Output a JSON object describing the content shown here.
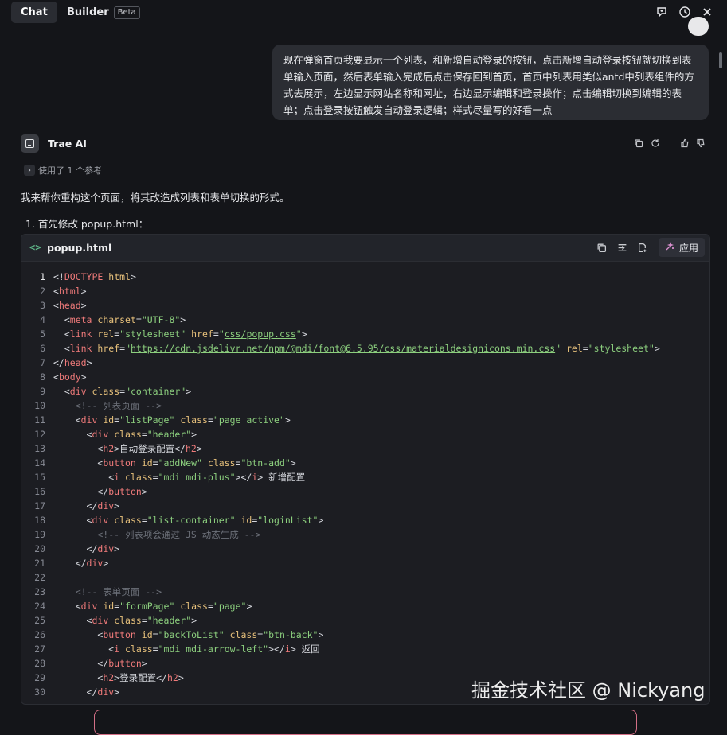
{
  "tabs": {
    "chat": "Chat",
    "builder": "Builder",
    "beta": "Beta"
  },
  "top_icons": [
    "new-chat-icon",
    "history-icon",
    "close-icon"
  ],
  "user_message": "现在弹窗首页我要显示一个列表，和新增自动登录的按钮，点击新增自动登录按钮就切换到表单输入页面，然后表单输入完成后点击保存回到首页，首页中列表用类似antd中列表组件的方式去展示，左边显示网站名称和网址，右边显示编辑和登录操作；点击编辑切换到编辑的表单；点击登录按钮触发自动登录逻辑；样式尽量写的好看一点",
  "ai": {
    "name": "Trae AI",
    "reference": "使用了 1 个参考",
    "intro": "我来帮你重构这个页面，将其改造成列表和表单切换的形式。",
    "step": "1. 首先修改 popup.html："
  },
  "code_block": {
    "filename": "popup.html",
    "apply_label": "应用",
    "current_line": 1,
    "lines": [
      {
        "n": "1",
        "tokens": [
          [
            "p",
            "<!"
          ],
          [
            "tag",
            "DOCTYPE"
          ],
          [
            "p",
            " "
          ],
          [
            "attr",
            "html"
          ],
          [
            "p",
            ">"
          ]
        ]
      },
      {
        "n": "2",
        "tokens": [
          [
            "p",
            "<"
          ],
          [
            "tag",
            "html"
          ],
          [
            "p",
            ">"
          ]
        ]
      },
      {
        "n": "3",
        "tokens": [
          [
            "p",
            "<"
          ],
          [
            "tag",
            "head"
          ],
          [
            "p",
            ">"
          ]
        ]
      },
      {
        "n": "4",
        "tokens": [
          [
            "p",
            "  <"
          ],
          [
            "tag",
            "meta"
          ],
          [
            "p",
            " "
          ],
          [
            "attr",
            "charset"
          ],
          [
            "p",
            "="
          ],
          [
            "str",
            "\"UTF-8\""
          ],
          [
            "p",
            ">"
          ]
        ]
      },
      {
        "n": "5",
        "tokens": [
          [
            "p",
            "  <"
          ],
          [
            "tag",
            "link"
          ],
          [
            "p",
            " "
          ],
          [
            "attr",
            "rel"
          ],
          [
            "p",
            "="
          ],
          [
            "str",
            "\"stylesheet\""
          ],
          [
            "p",
            " "
          ],
          [
            "attr",
            "href"
          ],
          [
            "p",
            "="
          ],
          [
            "str",
            "\""
          ],
          [
            "url",
            "css/popup.css"
          ],
          [
            "str",
            "\""
          ],
          [
            "p",
            ">"
          ]
        ]
      },
      {
        "n": "6",
        "tokens": [
          [
            "p",
            "  <"
          ],
          [
            "tag",
            "link"
          ],
          [
            "p",
            " "
          ],
          [
            "attr",
            "href"
          ],
          [
            "p",
            "="
          ],
          [
            "str",
            "\""
          ],
          [
            "url",
            "https://cdn.jsdelivr.net/npm/@mdi/font@6.5.95/css/materialdesignicons.min.css"
          ],
          [
            "str",
            "\""
          ],
          [
            "p",
            " "
          ],
          [
            "attr",
            "rel"
          ],
          [
            "p",
            "="
          ],
          [
            "str",
            "\"stylesheet\""
          ],
          [
            "p",
            ">"
          ]
        ]
      },
      {
        "n": "7",
        "tokens": [
          [
            "p",
            "</"
          ],
          [
            "tag",
            "head"
          ],
          [
            "p",
            ">"
          ]
        ]
      },
      {
        "n": "8",
        "tokens": [
          [
            "p",
            "<"
          ],
          [
            "tag",
            "body"
          ],
          [
            "p",
            ">"
          ]
        ]
      },
      {
        "n": "9",
        "tokens": [
          [
            "p",
            "  <"
          ],
          [
            "tag",
            "div"
          ],
          [
            "p",
            " "
          ],
          [
            "attr",
            "class"
          ],
          [
            "p",
            "="
          ],
          [
            "str",
            "\"container\""
          ],
          [
            "p",
            ">"
          ]
        ]
      },
      {
        "n": "10",
        "tokens": [
          [
            "cmt",
            "    <!-- 列表页面 -->"
          ]
        ]
      },
      {
        "n": "11",
        "tokens": [
          [
            "p",
            "    <"
          ],
          [
            "tag",
            "div"
          ],
          [
            "p",
            " "
          ],
          [
            "attr",
            "id"
          ],
          [
            "p",
            "="
          ],
          [
            "str",
            "\"listPage\""
          ],
          [
            "p",
            " "
          ],
          [
            "attr",
            "class"
          ],
          [
            "p",
            "="
          ],
          [
            "str",
            "\"page active\""
          ],
          [
            "p",
            ">"
          ]
        ]
      },
      {
        "n": "12",
        "tokens": [
          [
            "p",
            "      <"
          ],
          [
            "tag",
            "div"
          ],
          [
            "p",
            " "
          ],
          [
            "attr",
            "class"
          ],
          [
            "p",
            "="
          ],
          [
            "str",
            "\"header\""
          ],
          [
            "p",
            ">"
          ]
        ]
      },
      {
        "n": "13",
        "tokens": [
          [
            "p",
            "        <"
          ],
          [
            "tag",
            "h2"
          ],
          [
            "p",
            ">自动登录配置</"
          ],
          [
            "tag",
            "h2"
          ],
          [
            "p",
            ">"
          ]
        ]
      },
      {
        "n": "14",
        "tokens": [
          [
            "p",
            "        <"
          ],
          [
            "tag",
            "button"
          ],
          [
            "p",
            " "
          ],
          [
            "attr",
            "id"
          ],
          [
            "p",
            "="
          ],
          [
            "str",
            "\"addNew\""
          ],
          [
            "p",
            " "
          ],
          [
            "attr",
            "class"
          ],
          [
            "p",
            "="
          ],
          [
            "str",
            "\"btn-add\""
          ],
          [
            "p",
            ">"
          ]
        ]
      },
      {
        "n": "15",
        "tokens": [
          [
            "p",
            "          <"
          ],
          [
            "tag",
            "i"
          ],
          [
            "p",
            " "
          ],
          [
            "attr",
            "class"
          ],
          [
            "p",
            "="
          ],
          [
            "str",
            "\"mdi mdi-plus\""
          ],
          [
            "p",
            "></"
          ],
          [
            "tag",
            "i"
          ],
          [
            "p",
            "> 新增配置"
          ]
        ]
      },
      {
        "n": "16",
        "tokens": [
          [
            "p",
            "        </"
          ],
          [
            "tag",
            "button"
          ],
          [
            "p",
            ">"
          ]
        ]
      },
      {
        "n": "17",
        "tokens": [
          [
            "p",
            "      </"
          ],
          [
            "tag",
            "div"
          ],
          [
            "p",
            ">"
          ]
        ]
      },
      {
        "n": "18",
        "tokens": [
          [
            "p",
            "      <"
          ],
          [
            "tag",
            "div"
          ],
          [
            "p",
            " "
          ],
          [
            "attr",
            "class"
          ],
          [
            "p",
            "="
          ],
          [
            "str",
            "\"list-container\""
          ],
          [
            "p",
            " "
          ],
          [
            "attr",
            "id"
          ],
          [
            "p",
            "="
          ],
          [
            "str",
            "\"loginList\""
          ],
          [
            "p",
            ">"
          ]
        ]
      },
      {
        "n": "19",
        "tokens": [
          [
            "cmt",
            "        <!-- 列表项会通过 JS 动态生成 -->"
          ]
        ]
      },
      {
        "n": "20",
        "tokens": [
          [
            "p",
            "      </"
          ],
          [
            "tag",
            "div"
          ],
          [
            "p",
            ">"
          ]
        ]
      },
      {
        "n": "21",
        "tokens": [
          [
            "p",
            "    </"
          ],
          [
            "tag",
            "div"
          ],
          [
            "p",
            ">"
          ]
        ]
      },
      {
        "n": "22",
        "tokens": []
      },
      {
        "n": "23",
        "tokens": [
          [
            "cmt",
            "    <!-- 表单页面 -->"
          ]
        ]
      },
      {
        "n": "24",
        "tokens": [
          [
            "p",
            "    <"
          ],
          [
            "tag",
            "div"
          ],
          [
            "p",
            " "
          ],
          [
            "attr",
            "id"
          ],
          [
            "p",
            "="
          ],
          [
            "str",
            "\"formPage\""
          ],
          [
            "p",
            " "
          ],
          [
            "attr",
            "class"
          ],
          [
            "p",
            "="
          ],
          [
            "str",
            "\"page\""
          ],
          [
            "p",
            ">"
          ]
        ]
      },
      {
        "n": "25",
        "tokens": [
          [
            "p",
            "      <"
          ],
          [
            "tag",
            "div"
          ],
          [
            "p",
            " "
          ],
          [
            "attr",
            "class"
          ],
          [
            "p",
            "="
          ],
          [
            "str",
            "\"header\""
          ],
          [
            "p",
            ">"
          ]
        ]
      },
      {
        "n": "26",
        "tokens": [
          [
            "p",
            "        <"
          ],
          [
            "tag",
            "button"
          ],
          [
            "p",
            " "
          ],
          [
            "attr",
            "id"
          ],
          [
            "p",
            "="
          ],
          [
            "str",
            "\"backToList\""
          ],
          [
            "p",
            " "
          ],
          [
            "attr",
            "class"
          ],
          [
            "p",
            "="
          ],
          [
            "str",
            "\"btn-back\""
          ],
          [
            "p",
            ">"
          ]
        ]
      },
      {
        "n": "27",
        "tokens": [
          [
            "p",
            "          <"
          ],
          [
            "tag",
            "i"
          ],
          [
            "p",
            " "
          ],
          [
            "attr",
            "class"
          ],
          [
            "p",
            "="
          ],
          [
            "str",
            "\"mdi mdi-arrow-left\""
          ],
          [
            "p",
            "></"
          ],
          [
            "tag",
            "i"
          ],
          [
            "p",
            "> 返回"
          ]
        ]
      },
      {
        "n": "28",
        "tokens": [
          [
            "p",
            "        </"
          ],
          [
            "tag",
            "button"
          ],
          [
            "p",
            ">"
          ]
        ]
      },
      {
        "n": "29",
        "tokens": [
          [
            "p",
            "        <"
          ],
          [
            "tag",
            "h2"
          ],
          [
            "p",
            ">登录配置</"
          ],
          [
            "tag",
            "h2"
          ],
          [
            "p",
            ">"
          ]
        ]
      },
      {
        "n": "30",
        "tokens": [
          [
            "p",
            "      </"
          ],
          [
            "tag",
            "div"
          ],
          [
            "p",
            ">"
          ]
        ]
      }
    ]
  },
  "watermark": "掘金技术社区 @ Nickyang"
}
